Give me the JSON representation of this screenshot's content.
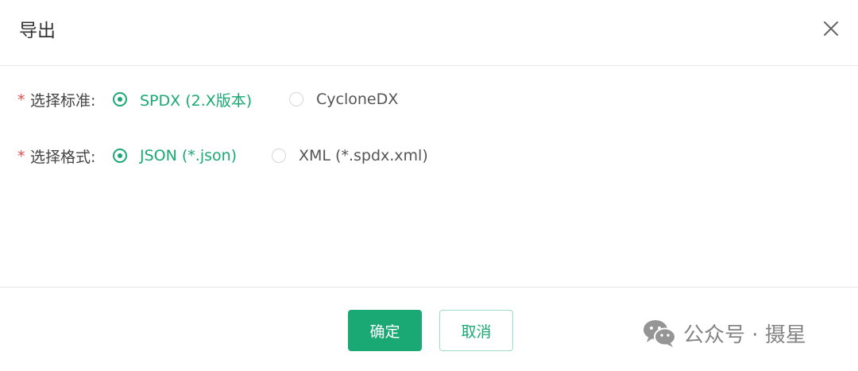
{
  "dialog": {
    "title": "导出",
    "close_icon": "close-icon"
  },
  "form": {
    "standard": {
      "required_mark": "*",
      "label": "选择标准:",
      "options": [
        {
          "label": "SPDX (2.X版本)",
          "selected": true
        },
        {
          "label": "CycloneDX",
          "selected": false
        }
      ]
    },
    "format": {
      "required_mark": "*",
      "label": "选择格式:",
      "options": [
        {
          "label": "JSON (*.json)",
          "selected": true
        },
        {
          "label": "XML (*.spdx.xml)",
          "selected": false
        }
      ]
    }
  },
  "footer": {
    "confirm_label": "确定",
    "cancel_label": "取消",
    "watermark": {
      "icon": "wechat-icon",
      "text": "公众号 · 摄星"
    }
  },
  "colors": {
    "accent": "#1aa974",
    "required": "#e04e4e",
    "border": "#e8e8e8"
  }
}
